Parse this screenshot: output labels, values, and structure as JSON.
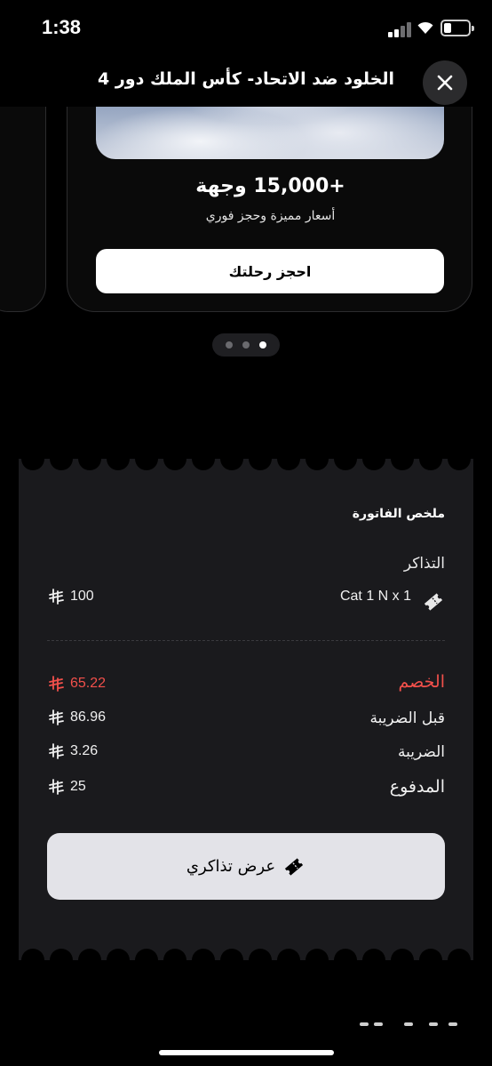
{
  "status_bar": {
    "time": "1:38"
  },
  "header": {
    "title": "الخلود ضد الاتحاد- كأس الملك دور 4",
    "close_icon": "close-icon"
  },
  "promo_card": {
    "headline": "+15,000 وجهة",
    "subtitle": "أسعار مميزة وحجز فوري",
    "button_label": "احجز رحلتك"
  },
  "carousel": {
    "page_count": 3,
    "active_index": 2
  },
  "invoice": {
    "title": "ملخص الفاتورة",
    "tickets_label": "التذاكر",
    "ticket_item": {
      "name": "Cat 1 N x 1",
      "amount": "100"
    },
    "discount": {
      "label": "الخصم",
      "amount": "65.22"
    },
    "pre_tax": {
      "label": "قبل الضريبة",
      "amount": "86.96"
    },
    "tax": {
      "label": "الضريبة",
      "amount": "3.26"
    },
    "paid": {
      "label": "المدفوع",
      "amount": "25"
    },
    "view_tickets_label": "عرض تذاكري",
    "discount_color": "#f2504b"
  }
}
